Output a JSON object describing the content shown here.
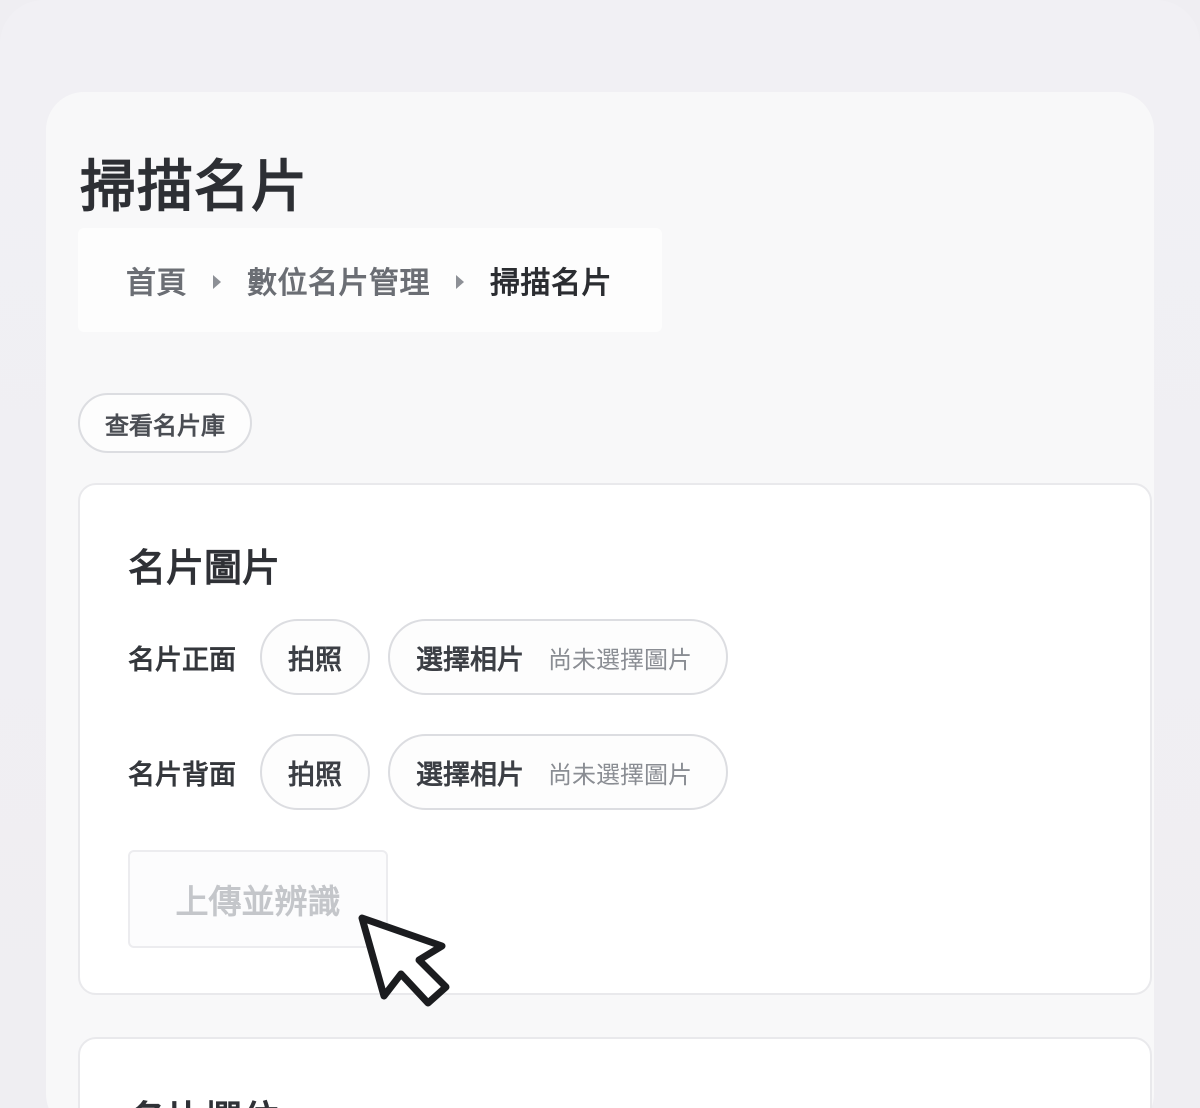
{
  "page": {
    "title": "掃描名片"
  },
  "breadcrumb": {
    "items": [
      "首頁",
      "數位名片管理",
      "掃描名片"
    ]
  },
  "actions": {
    "view_library": "查看名片庫"
  },
  "card_images": {
    "title": "名片圖片",
    "front": {
      "label": "名片正面",
      "photo_button": "拍照",
      "select_button": "選擇相片",
      "status": "尚未選擇圖片"
    },
    "back": {
      "label": "名片背面",
      "photo_button": "拍照",
      "select_button": "選擇相片",
      "status": "尚未選擇圖片"
    },
    "upload_button": "上傳並辨識",
    "upload_disabled": true
  },
  "card_fields": {
    "title": "名片欄位"
  },
  "icons": {
    "breadcrumb_separator": "caret-right-icon",
    "pointer": "mouse-pointer-icon"
  },
  "colors": {
    "background": "#efeef2",
    "panel": "#f8f8f9",
    "text_primary": "#2d2f34",
    "border": "#dcdde1",
    "disabled_text": "#c4c6ca"
  }
}
